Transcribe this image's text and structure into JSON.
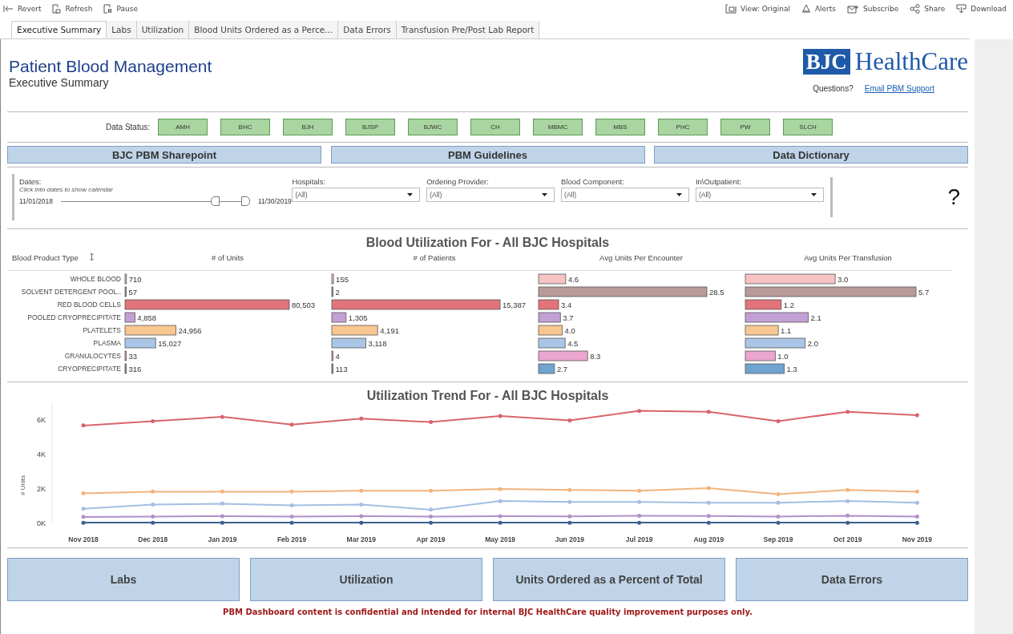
{
  "toolbar": {
    "left": [
      {
        "label": "Revert"
      },
      {
        "label": "Refresh"
      },
      {
        "label": "Pause"
      }
    ],
    "right": [
      {
        "label": "View: Original"
      },
      {
        "label": "Alerts"
      },
      {
        "label": "Subscribe"
      },
      {
        "label": "Share"
      },
      {
        "label": "Download"
      }
    ]
  },
  "tabs": [
    {
      "label": "Executive Summary",
      "selected": true
    },
    {
      "label": "Labs",
      "selected": false
    },
    {
      "label": "Utilization",
      "selected": false
    },
    {
      "label": "Blood Units Ordered as a Perce...",
      "selected": false
    },
    {
      "label": "Data Errors",
      "selected": false
    },
    {
      "label": "Transfusion Pre/Post Lab Report",
      "selected": false
    }
  ],
  "header": {
    "title": "Patient Blood Management",
    "subtitle": "Executive Summary",
    "logo_mark": "BJC",
    "logo_text": "HealthCare",
    "questions": "Questions?",
    "support_link": "Email PBM Support"
  },
  "data_status": {
    "label": "Data Status:",
    "items": [
      {
        "label": "AMH",
        "color": "#a9d5a0"
      },
      {
        "label": "BHC",
        "color": "#a9d5a0"
      },
      {
        "label": "BJH",
        "color": "#a9d5a0"
      },
      {
        "label": "BJSP",
        "color": "#a9d5a0"
      },
      {
        "label": "BJWC",
        "color": "#a9d5a0"
      },
      {
        "label": "CH",
        "color": "#a9d5a0"
      },
      {
        "label": "MBMC",
        "color": "#a9d5a0"
      },
      {
        "label": "MBS",
        "color": "#a9d5a0"
      },
      {
        "label": "PHC",
        "color": "#a9d5a0"
      },
      {
        "label": "PW",
        "color": "#a9d5a0"
      },
      {
        "label": "SLCH",
        "color": "#a9d5a0"
      }
    ]
  },
  "links": [
    "BJC PBM Sharepoint",
    "PBM Guidelines",
    "Data Dictionary"
  ],
  "filters": {
    "dates": {
      "label": "Dates:",
      "hint": "Click into dates to show calendar",
      "start": "11/01/2018",
      "end": "11/30/2019",
      "level": 0.83
    },
    "dropdowns": [
      {
        "label": "Hospitals:",
        "value": "(All)"
      },
      {
        "label": "Ordering Provider:",
        "value": "(All)"
      },
      {
        "label": "Blood Component:",
        "value": "(All)"
      },
      {
        "label": "In\\Outpatient:",
        "value": "(All)"
      }
    ],
    "help": "?"
  },
  "utilization": {
    "title": "Blood Utilization For - All BJC Hospitals",
    "row_header": "Blood Product Type",
    "products": [
      {
        "color": "#f6c3c3"
      },
      {
        "color": "#b89b98"
      },
      {
        "color": "#e2737a"
      },
      {
        "color": "#c3a0d4"
      },
      {
        "color": "#f9c690"
      },
      {
        "color": "#a9c6e6"
      },
      {
        "color": "#eaa6cf"
      },
      {
        "color": "#6fa4d1"
      }
    ],
    "panels": [
      {
        "chart_data": {
          "type": "bar",
          "orientation": "horizontal",
          "title": "# of Units",
          "categories": [
            "WHOLE BLOOD",
            "SOLVENT DETERGENT POOL..",
            "RED BLOOD CELLS",
            "POOLED CRYOPRECIPITATE",
            "PLATELETS",
            "PLASMA",
            "GRANULOCYTES",
            "CRYOPRECIPITATE"
          ],
          "values": [
            710,
            57,
            80503,
            4858,
            24956,
            15027,
            33,
            316
          ],
          "value_labels": [
            "710",
            "57",
            "80,503",
            "4,858",
            "24,956",
            "15,027",
            "33",
            "316"
          ]
        }
      },
      {
        "chart_data": {
          "type": "bar",
          "orientation": "horizontal",
          "title": "# of Patients",
          "categories": [
            null,
            null,
            null,
            null,
            null,
            null,
            null,
            null
          ],
          "values": [
            155,
            2,
            15387,
            1305,
            4191,
            3118,
            4,
            113
          ],
          "value_labels": [
            "155",
            "2",
            "15,387",
            "1,305",
            "4,191",
            "3,118",
            "4",
            "113"
          ]
        }
      },
      {
        "chart_data": {
          "type": "bar",
          "orientation": "horizontal",
          "title": "Avg Units Per Encounter",
          "categories": [
            null,
            null,
            null,
            null,
            null,
            null,
            null,
            null
          ],
          "values": [
            4.6,
            28.5,
            3.4,
            3.7,
            4.0,
            4.5,
            8.3,
            2.7
          ],
          "value_labels": [
            "4.6",
            "28.5",
            "3.4",
            "3.7",
            "4.0",
            "4.5",
            "8.3",
            "2.7"
          ]
        }
      },
      {
        "chart_data": {
          "type": "bar",
          "orientation": "horizontal",
          "title": "Avg Units Per Transfusion",
          "categories": [
            null,
            null,
            null,
            null,
            null,
            null,
            null,
            null
          ],
          "values": [
            3.0,
            5.7,
            1.2,
            2.1,
            1.1,
            2.0,
            1.0,
            1.3
          ],
          "value_labels": [
            "3.0",
            "5.7",
            "1.2",
            "2.1",
            "1.1",
            "2.0",
            "1.0",
            "1.3"
          ]
        }
      }
    ]
  },
  "trend": {
    "chart_data": {
      "type": "line",
      "title": "Utilization Trend For - All BJC Hospitals",
      "ylabel": "# Units",
      "categories": [
        "Nov 2018",
        "Dec 2018",
        "Jan 2019",
        "Feb 2019",
        "Mar 2019",
        "Apr 2019",
        "May 2019",
        "Jun 2019",
        "Jul 2019",
        "Aug 2019",
        "Sep 2019",
        "Oct 2019",
        "Nov 2019"
      ],
      "ylim": [
        0,
        7000
      ],
      "yticks": [
        {
          "value": 0,
          "label": "0K"
        },
        {
          "value": 2000,
          "label": "2K"
        },
        {
          "value": 4000,
          "label": "4K"
        },
        {
          "value": 6000,
          "label": "6K"
        }
      ],
      "series": [
        {
          "color": "#d9646c",
          "values": [
            5700,
            5950,
            6200,
            5750,
            6100,
            5900,
            6250,
            6000,
            6550,
            6500,
            5950,
            6500,
            6300
          ]
        },
        {
          "color": "#f2b47e",
          "values": [
            1750,
            1850,
            1850,
            1850,
            1900,
            1900,
            2000,
            1950,
            1900,
            2050,
            1700,
            1950,
            1850
          ]
        },
        {
          "color": "#a2bfe2",
          "values": [
            850,
            1100,
            1150,
            1050,
            1100,
            800,
            1300,
            1250,
            1250,
            1200,
            1200,
            1300,
            1200
          ]
        },
        {
          "color": "#b290cb",
          "values": [
            380,
            400,
            420,
            400,
            420,
            400,
            420,
            410,
            440,
            430,
            400,
            450,
            400
          ]
        },
        {
          "color": "#3d5f8f",
          "values": [
            40,
            40,
            40,
            40,
            40,
            40,
            40,
            40,
            40,
            40,
            40,
            40,
            40
          ]
        }
      ]
    }
  },
  "nav_buttons": [
    "Labs",
    "Utilization",
    "Units Ordered as a Percent of Total",
    "Data Errors"
  ],
  "footer": "PBM Dashboard content is confidential and intended for internal BJC HealthCare quality improvement purposes only."
}
